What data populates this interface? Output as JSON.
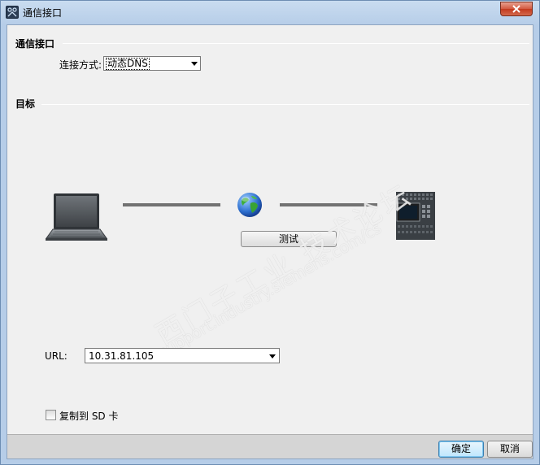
{
  "window": {
    "title": "通信接口"
  },
  "section_interface": {
    "heading": "通信接口",
    "connection_label": "连接方式:",
    "connection_value": "动态DNS"
  },
  "section_target": {
    "heading": "目标",
    "test_button": "测试"
  },
  "url": {
    "label": "URL:",
    "value": "10.31.81.105"
  },
  "copy_sd": {
    "label": "复制到 SD 卡",
    "checked": false
  },
  "watermark": {
    "line1": "西门子工业 技术论坛",
    "line2": "support.industry.siemens.com/cs"
  },
  "buttons": {
    "ok": "确定",
    "cancel": "取消"
  },
  "colors": {
    "accent": "#3c7fb1",
    "frame": "#b6cde8",
    "client": "#f0f0f0",
    "footer": "#d5d5d5",
    "close": "#c3391d"
  },
  "icons": [
    "app-icon",
    "close-icon",
    "chevron-down-icon",
    "laptop-icon",
    "globe-icon",
    "plc-device-icon"
  ]
}
